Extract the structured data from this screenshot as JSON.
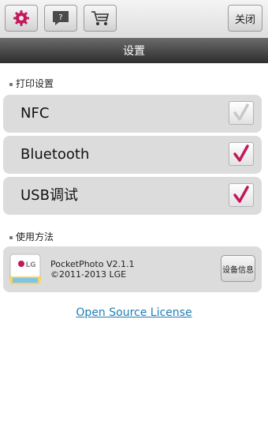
{
  "toolbar": {
    "icons": [
      "gear-icon",
      "help-icon",
      "cart-icon"
    ],
    "close_label": "关闭"
  },
  "title": "设置",
  "print_settings": {
    "header": "打印设置",
    "items": [
      {
        "label": "NFC",
        "checked": false
      },
      {
        "label": "Bluetooth",
        "checked": true
      },
      {
        "label": "USB调试",
        "checked": true
      }
    ]
  },
  "usage": {
    "header": "使用方法",
    "app_name": "PocketPhoto V2.1.1",
    "copyright": "©2011-2013 LGE",
    "device_info_label": "设备信息",
    "logo_text": "LG"
  },
  "open_source_label": "Open Source License",
  "colors": {
    "accent": "#c2185b",
    "link": "#1e7fb5"
  }
}
